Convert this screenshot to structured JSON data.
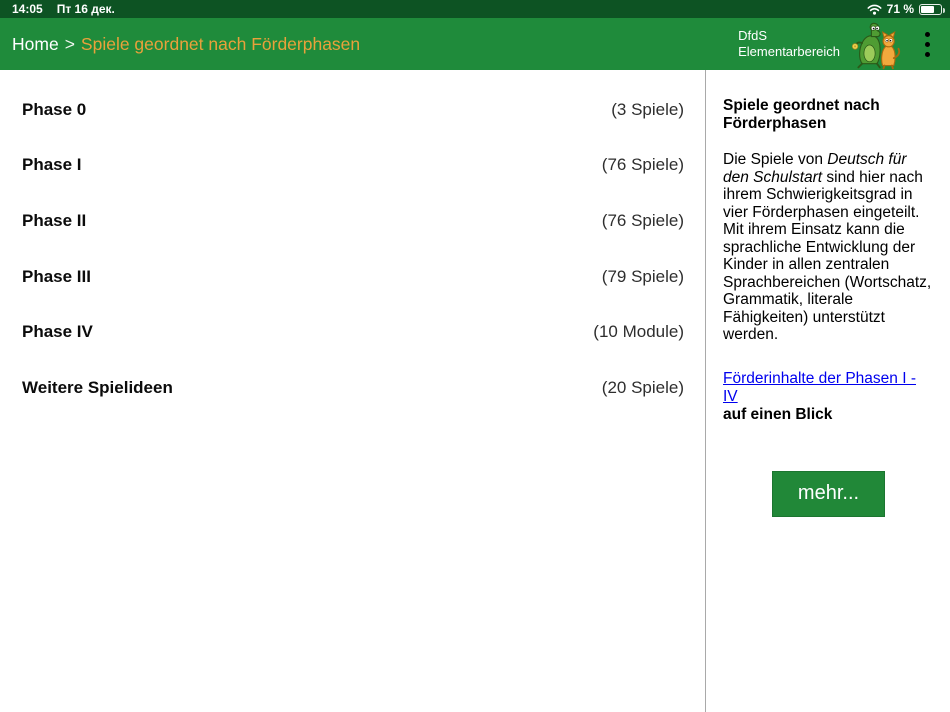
{
  "status_bar": {
    "time": "14:05",
    "date": "Пт 16 дек.",
    "battery_percent": "71 %"
  },
  "nav": {
    "home": "Home",
    "separator": ">",
    "current": "Spiele geordnet nach Förderphasen",
    "app_title_line1": "DfdS",
    "app_title_line2": "Elementarbereich",
    "colors": {
      "bar": "#1f8b3b",
      "status_bar": "#0d5323",
      "breadcrumb_current": "#e9a13b"
    }
  },
  "phases": [
    {
      "label": "Phase 0",
      "count": "(3 Spiele)"
    },
    {
      "label": "Phase I",
      "count": "(76 Spiele)"
    },
    {
      "label": "Phase II",
      "count": "(76 Spiele)"
    },
    {
      "label": "Phase III",
      "count": "(79 Spiele)"
    },
    {
      "label": "Phase IV",
      "count": "(10 Module)"
    },
    {
      "label": "Weitere Spielideen",
      "count": "(20 Spiele)"
    }
  ],
  "sidebar": {
    "heading": "Spiele geordnet nach Förderphasen",
    "paragraph_pre": "Die Spiele von ",
    "paragraph_italic": "Deutsch für den Schulstart",
    "paragraph_post": " sind hier nach ihrem Schwierigkeitsgrad in vier Förderphasen eingeteilt. Mit ihrem Einsatz kann die sprachliche Entwicklung der Kinder in allen zentralen Sprachbereichen (Wortschatz, Grammatik, literale Fähigkeiten) unterstützt werden.",
    "link_text": "Förderinhalte der Phasen I - IV",
    "link_suffix": "auf einen Blick",
    "more_button": "mehr...",
    "button_color": "#218838"
  }
}
